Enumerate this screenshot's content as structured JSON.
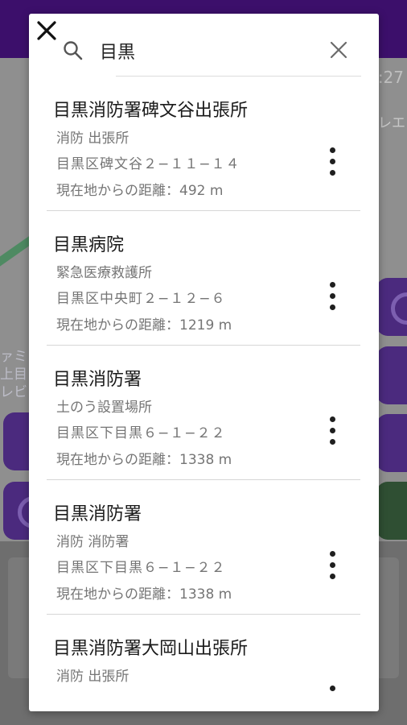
{
  "search": {
    "value": "目黒"
  },
  "results": [
    {
      "name": "目黒消防署碑文谷出張所",
      "category": "消防 出張所",
      "address": "目黒区碑文谷２−１１−１４",
      "distance": "現在地からの距離：492 m"
    },
    {
      "name": "目黒病院",
      "category": "緊急医療救護所",
      "address": "目黒区中央町２−１２−６",
      "distance": "現在地からの距離：1219 m"
    },
    {
      "name": "目黒消防署",
      "category": "土のう設置場所",
      "address": "目黒区下目黒６−１−２２",
      "distance": "現在地からの距離：1338 m"
    },
    {
      "name": "目黒消防署",
      "category": "消防 消防署",
      "address": "目黒区下目黒６−１−２２",
      "distance": "現在地からの距離：1338 m"
    },
    {
      "name": "目黒消防署大岡山出張所",
      "category": "消防 出張所",
      "address": "",
      "distance": ""
    }
  ],
  "background": {
    "time": ":27",
    "side_label": "レエ",
    "map_labels": [
      "ァミ",
      "上目",
      "レビ"
    ]
  },
  "icons": {
    "close": "close-icon",
    "search": "search-icon",
    "clear": "clear-icon",
    "more": "more-vert-icon"
  },
  "colors": {
    "toolbar": "#3c0f6b",
    "accent": "#4b2a7e"
  }
}
